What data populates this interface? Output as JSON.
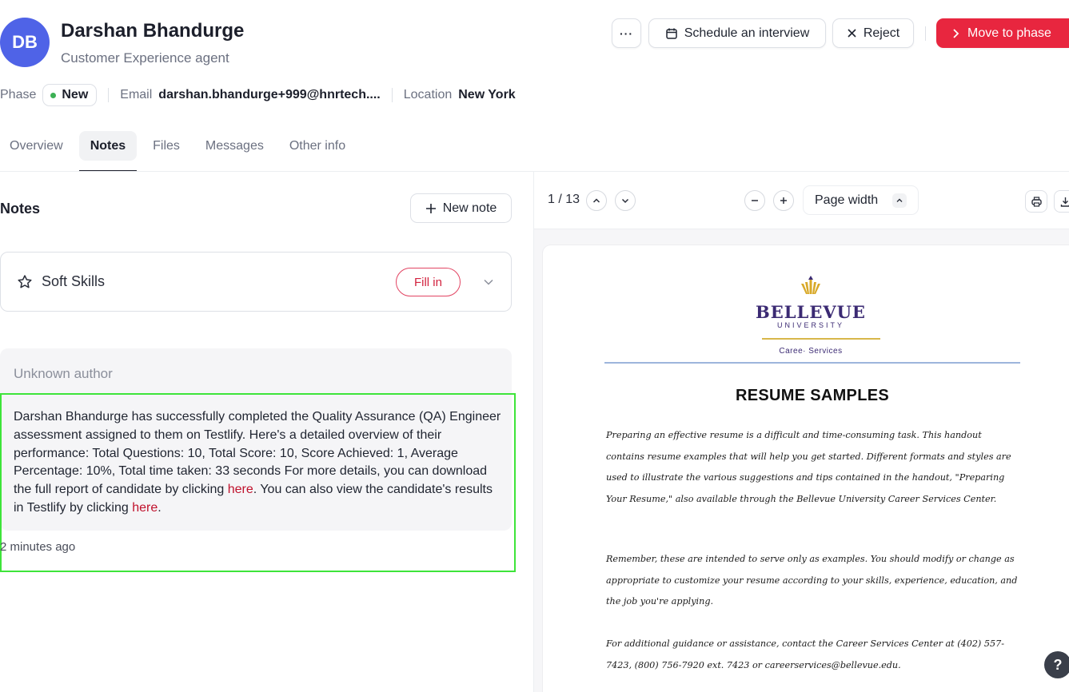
{
  "candidate": {
    "initials": "DB",
    "name": "Darshan Bhandurge",
    "role": "Customer Experience agent"
  },
  "header_actions": {
    "more_label": "···",
    "schedule_label": "Schedule an interview",
    "reject_label": "Reject",
    "move_label": "Move to phase"
  },
  "meta": {
    "phase_label": "Phase",
    "phase_value": "New",
    "email_label": "Email",
    "email_value": "darshan.bhandurge+999@hnrtech....",
    "location_label": "Location",
    "location_value": "New York"
  },
  "tabs": [
    {
      "label": "Overview",
      "active": false
    },
    {
      "label": "Notes",
      "active": true
    },
    {
      "label": "Files",
      "active": false
    },
    {
      "label": "Messages",
      "active": false
    },
    {
      "label": "Other info",
      "active": false
    }
  ],
  "notes": {
    "title": "Notes",
    "new_note_label": "New note",
    "scorecard": {
      "label": "Soft Skills",
      "action_label": "Fill in"
    },
    "note": {
      "author": "Unknown author",
      "text_part1": "Darshan Bhandurge has successfully completed the Quality Assurance (QA) Engineer assessment assigned to them on Testlify. Here's a detailed overview of their performance: Total Questions: 10, Total Score: 10, Score Achieved: 1, Average Percentage: 10%, Total time taken: 33 seconds For more details, you can download the full report of candidate by clicking ",
      "link1": "here",
      "text_part2": ". You can also view the candidate's results in Testlify by clicking ",
      "link2": "here",
      "text_part3": ".",
      "time": "2 minutes ago"
    }
  },
  "viewer": {
    "page_counter": "1 / 13",
    "zoom_mode": "Page width"
  },
  "document": {
    "university": "BELLEVUE",
    "university_sub": "UNIVERSITY",
    "career_services": "Caree· Services",
    "title": "RESUME SAMPLES",
    "paragraph1": "Preparing an effective resume is a difficult and time-consuming task.  This handout contains resume examples that will help you get started.  Different formats and styles are used to illustrate the various suggestions and tips contained in the handout, \"Preparing Your Resume,\" also available through the Bellevue University Career Services Center.",
    "paragraph2": "Remember, these are intended to serve only as examples.  You should modify or change as appropriate to customize your resume according to your skills, experience, education, and the job you're applying.",
    "paragraph3": "For additional guidance or assistance, contact the Career Services Center at (402) 557-7423, (800) 756-7920 ext. 7423 or careerservices@bellevue.edu."
  },
  "help_label": "?",
  "colors": {
    "accent": "#e8263f",
    "avatar": "#4f63e7",
    "phase_dot": "#3cb054",
    "link": "#c0112c",
    "highlight": "#3ee43a"
  },
  "icons": [
    "calendar-icon",
    "close-icon",
    "chevron-right-icon",
    "plus-icon",
    "star-icon",
    "chevron-down-icon",
    "chevron-up-icon",
    "minus-icon",
    "print-icon",
    "download-icon"
  ]
}
